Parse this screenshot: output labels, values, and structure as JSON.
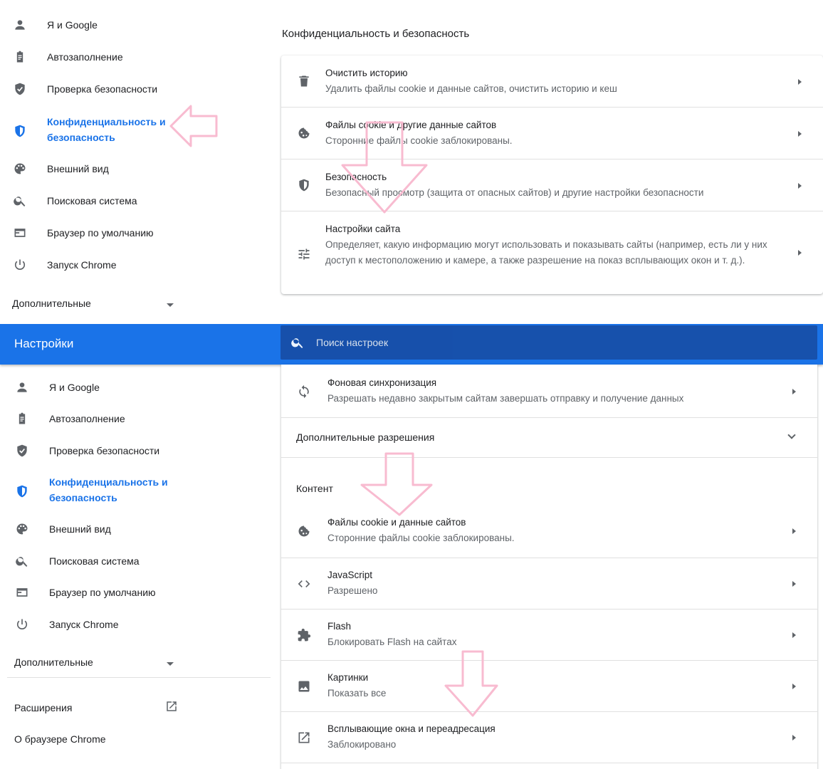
{
  "sidebar": {
    "items": [
      {
        "label": "Я и Google",
        "icon": "person-icon"
      },
      {
        "label": "Автозаполнение",
        "icon": "clipboard-icon"
      },
      {
        "label": "Проверка безопасности",
        "icon": "shield-check-icon"
      },
      {
        "label": "Конфиденциальность и безопасность",
        "line1": "Конфиденциальность и",
        "line2": "безопасность",
        "icon": "shield-icon",
        "active": true
      },
      {
        "label": "Внешний вид",
        "icon": "palette-icon"
      },
      {
        "label": "Поисковая система",
        "icon": "search-icon"
      },
      {
        "label": "Браузер по умолчанию",
        "icon": "browser-icon"
      },
      {
        "label": "Запуск Chrome",
        "icon": "power-icon"
      }
    ],
    "advanced_label": "Дополнительные",
    "extensions_label": "Расширения",
    "about_label": "О браузере Chrome"
  },
  "top_panel": {
    "section_title": "Конфиденциальность и безопасность",
    "rows": [
      {
        "title": "Очистить историю",
        "subtitle": "Удалить файлы cookie и данные сайтов, очистить историю и кеш",
        "icon": "trash-icon"
      },
      {
        "title": "Файлы cookie и другие данные сайтов",
        "subtitle": "Сторонние файлы cookie заблокированы.",
        "icon": "cookie-icon"
      },
      {
        "title": "Безопасность",
        "subtitle": "Безопасный просмотр (защита от опасных сайтов) и другие настройки безопасности",
        "icon": "shield-icon"
      },
      {
        "title": "Настройки сайта",
        "subtitle": "Определяет, какую информацию могут использовать и показывать сайты (например, есть ли у них доступ к местоположению и камере, а также разрешение на показ всплывающих окон и т. д.).",
        "icon": "tune-icon"
      }
    ]
  },
  "header": {
    "title": "Настройки",
    "search_placeholder": "Поиск настроек"
  },
  "bottom_panel": {
    "sync_row": {
      "title": "Фоновая синхронизация",
      "subtitle": "Разрешать недавно закрытым сайтам завершать отправку и получение данных",
      "icon": "sync-icon"
    },
    "additional_permissions": "Дополнительные разрешения",
    "content_label": "Контент",
    "content_rows": [
      {
        "title": "Файлы cookie и данные сайтов",
        "subtitle": "Сторонние файлы cookie заблокированы.",
        "icon": "cookie-icon"
      },
      {
        "title": "JavaScript",
        "subtitle": "Разрешено",
        "icon": "code-icon"
      },
      {
        "title": "Flash",
        "subtitle": "Блокировать Flash на сайтах",
        "icon": "puzzle-icon"
      },
      {
        "title": "Картинки",
        "subtitle": "Показать все",
        "icon": "image-icon"
      },
      {
        "title": "Всплывающие окна и переадресация",
        "subtitle": "Заблокировано",
        "icon": "open-in-new-icon"
      }
    ]
  },
  "colors": {
    "accent": "#1a73e8",
    "header_bg": "#1a73e8",
    "search_bg": "#174ea6",
    "annotation": "#f8bbd0"
  }
}
